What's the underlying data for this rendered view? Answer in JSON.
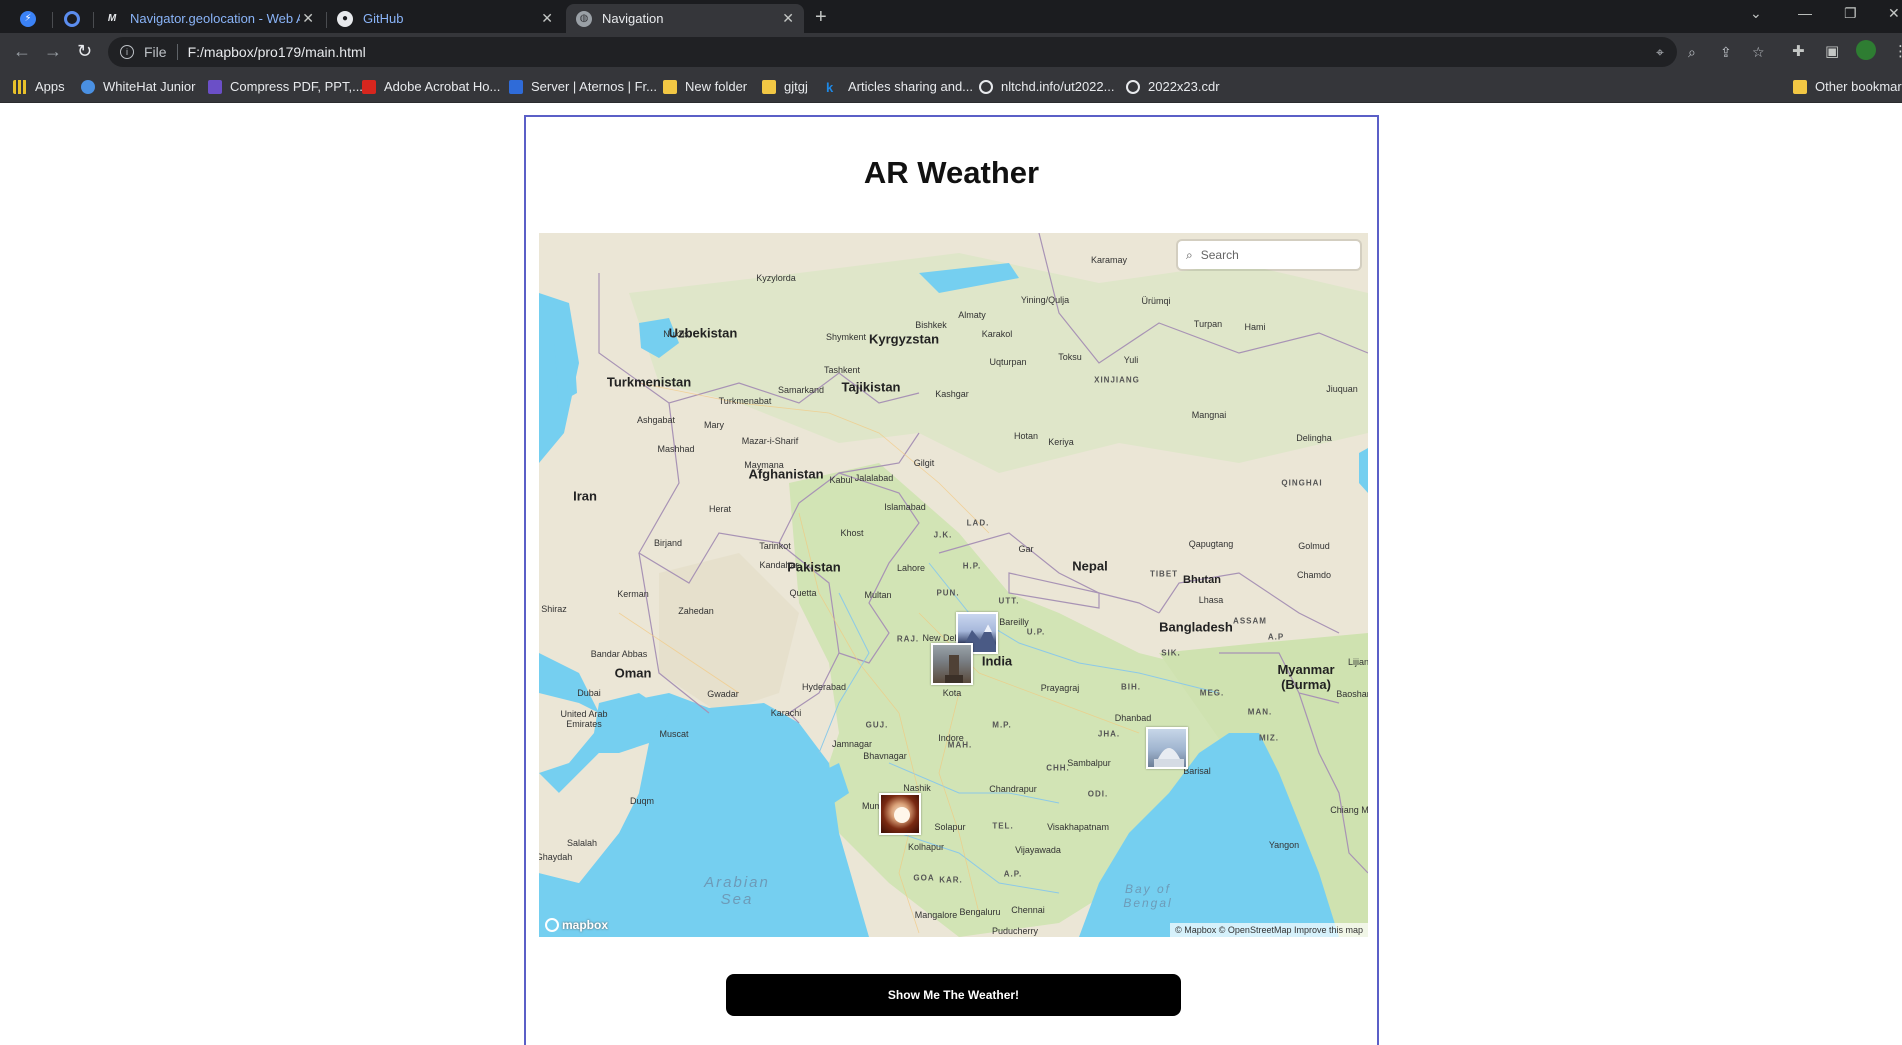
{
  "browser": {
    "tabs": [
      {
        "label": ""
      },
      {
        "label": ""
      },
      {
        "label": "Navigator.geolocation - Web AP"
      },
      {
        "label": "GitHub"
      },
      {
        "label": "Navigation"
      }
    ],
    "url_scheme": "File",
    "url": "F:/mapbox/pro179/main.html",
    "bookmarks": [
      {
        "label": "Apps",
        "icon": "apps-grid-icon",
        "color": "#e8c12a"
      },
      {
        "label": "WhiteHat Junior",
        "icon": "whitehat-icon",
        "color": "#4a90e2"
      },
      {
        "label": "Compress PDF, PPT,...",
        "icon": "w-logo-icon",
        "color": "#6b4fc7"
      },
      {
        "label": "Adobe Acrobat Ho...",
        "icon": "acrobat-icon",
        "color": "#d7261e"
      },
      {
        "label": "Server | Aternos | Fr...",
        "icon": "aternos-icon",
        "color": "#2f6bd8"
      },
      {
        "label": "New folder",
        "icon": "folder-icon",
        "color": "#f2c744"
      },
      {
        "label": "gjtgj",
        "icon": "folder-icon",
        "color": "#f2c744"
      },
      {
        "label": "Articles sharing and...",
        "icon": "k-logo-icon",
        "color": "#1e88e5"
      },
      {
        "label": "nltchd.info/ut2022...",
        "icon": "globe-icon",
        "color": "#e8eaed"
      },
      {
        "label": "2022x23.cdr",
        "icon": "globe-icon",
        "color": "#e8eaed"
      },
      {
        "label": "Other bookmark",
        "icon": "folder-icon",
        "color": "#f2c744"
      }
    ]
  },
  "page": {
    "title": "AR Weather",
    "search_placeholder": "Search",
    "button_label": "Show Me The Weather!",
    "map_logo": "mapbox",
    "attribution": "© Mapbox © OpenStreetMap  Improve this map",
    "colors": {
      "water": "#75cff0",
      "land": "#e8e4d8",
      "green": "#cfe3b5",
      "border": "#5b5fc7"
    }
  },
  "map_labels": {
    "countries": [
      "Uzbekistan",
      "Kyrgyzstan",
      "Turkmenistan",
      "Tajikistan",
      "Afghanistan",
      "Iran",
      "Pakistan",
      "Nepal",
      "Bhutan",
      "Bangladesh",
      "India",
      "Oman",
      "Myanmar (Burma)",
      "United Arab Emirates"
    ],
    "seas": [
      "Arabian Sea",
      "Bay of Bengal"
    ],
    "regions": [
      "XINJIANG",
      "QINGHAI",
      "TIBET",
      "ASSAM",
      "MAH.",
      "GUJ.",
      "RAJ.",
      "M.P.",
      "U.P.",
      "CHH.",
      "ODI.",
      "TEL.",
      "KAR.",
      "GOA",
      "A.P.",
      "PUN.",
      "H.P.",
      "UTT.",
      "J.K.",
      "LAD.",
      "JHA.",
      "BIH.",
      "SIK.",
      "MEG.",
      "MIZ.",
      "MAN.",
      "A.P"
    ],
    "cities": [
      "Karamay",
      "Kyzylorda",
      "Bishkek",
      "Almaty",
      "Yining/Qulja",
      "Ürümqi",
      "Turpan",
      "Hami",
      "Nukus",
      "Shymkent",
      "Karakol",
      "Tashkent",
      "Uqturpan",
      "Toksu",
      "Yuli",
      "Samarkand",
      "Turkmenabat",
      "Kashgar",
      "Jiuquan",
      "Ashgabat",
      "Mary",
      "Mangnai",
      "Mashhad",
      "Mazar-i-Sharif",
      "Hotan",
      "Keriya",
      "Delingha",
      "Maymana",
      "Kabul",
      "Jalalabad",
      "Gilgit",
      "Herat",
      "Islamabad",
      "Birjand",
      "Khost",
      "Gar",
      "Golmud",
      "Tarinkot",
      "Kandahar",
      "Lahore",
      "Qapugtang",
      "Chamdo",
      "Kerman",
      "Quetta",
      "Multan",
      "Lhasa",
      "Shiraz",
      "Zahedan",
      "Bareilly",
      "New Delhi",
      "Bandar Abbas",
      "Hyderabad",
      "Kota",
      "Prayagraj",
      "Dhanbad",
      "Baoshan",
      "Dubai",
      "Gwadar",
      "Karachi",
      "Lijiang",
      "Jamnagar",
      "Indore",
      "Muscat",
      "Bhavnagar",
      "Sambalpur",
      "Barisal",
      "Nashik",
      "Chandrapur",
      "Mumbai",
      "Solapur",
      "Duqm",
      "Visakhapatnam",
      "Chiang Mai",
      "Kolhapur",
      "Vijayawada",
      "Salalah",
      "Yangon",
      "Ghaydah",
      "Bengaluru",
      "Chennai",
      "Mangalore",
      "Puducherry"
    ]
  }
}
